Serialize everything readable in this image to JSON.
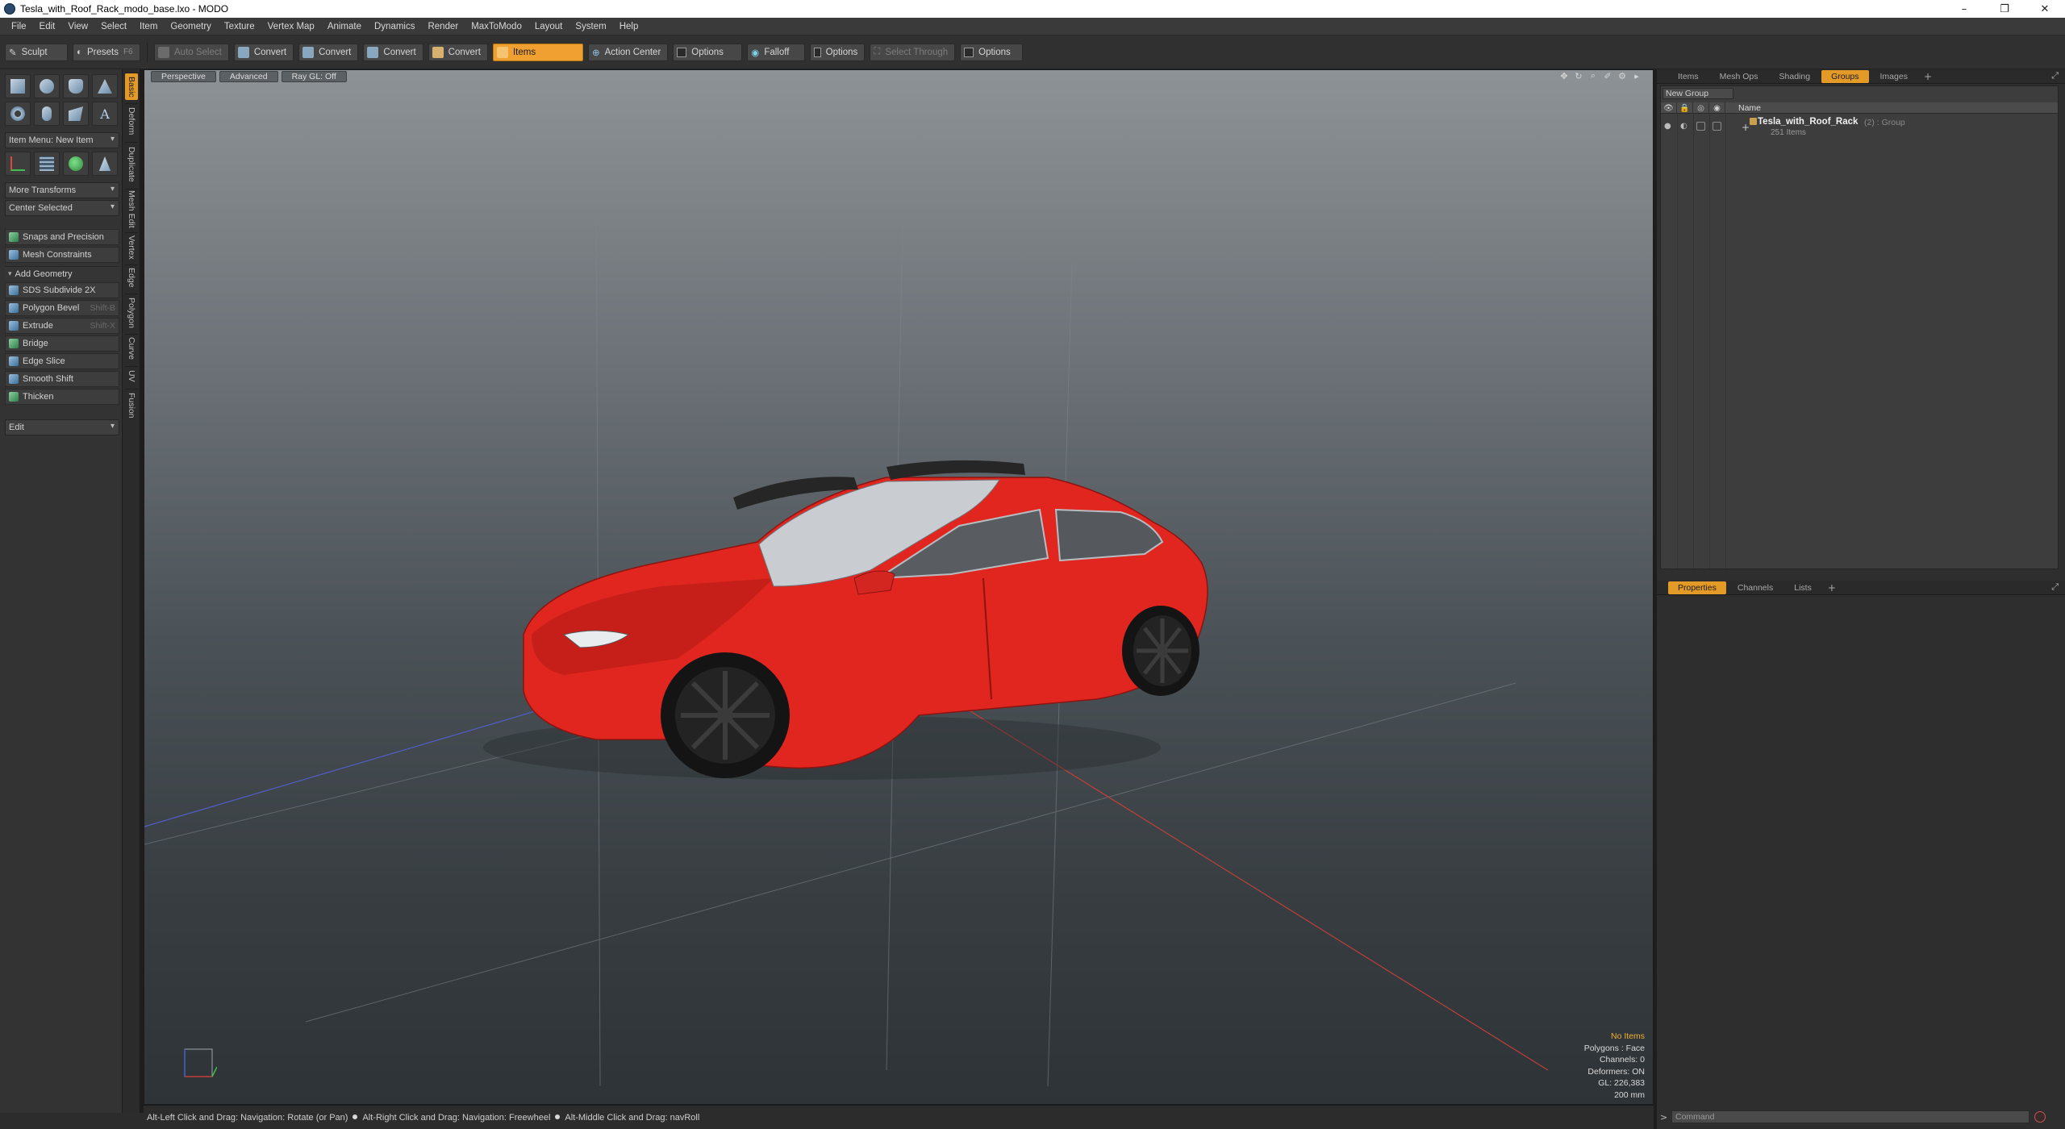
{
  "window": {
    "title": "Tesla_with_Roof_Rack_modo_base.lxo - MODO",
    "controls": [
      "–",
      "❐",
      "✕"
    ]
  },
  "menu": [
    "File",
    "Edit",
    "View",
    "Select",
    "Item",
    "Geometry",
    "Texture",
    "Vertex Map",
    "Animate",
    "Dynamics",
    "Render",
    "MaxToModo",
    "Layout",
    "System",
    "Help"
  ],
  "toolbar": {
    "sculpt": "Sculpt",
    "presets": "Presets",
    "presets_key": "F6",
    "auto_select": "Auto Select",
    "convert1": "Convert",
    "convert2": "Convert",
    "convert3": "Convert",
    "convert4": "Convert",
    "items": "Items",
    "action_center": "Action Center",
    "options1": "Options",
    "falloff": "Falloff",
    "options2": "Options",
    "select_through": "Select Through",
    "options3": "Options"
  },
  "left_panel": {
    "item_menu": "Item Menu: New Item",
    "more_transforms": "More Transforms",
    "center_selected": "Center Selected",
    "snaps": "Snaps and Precision",
    "mesh_constraints": "Mesh Constraints",
    "add_geometry": "Add Geometry",
    "tools": [
      {
        "label": "SDS Subdivide 2X",
        "shortcut": ""
      },
      {
        "label": "Polygon Bevel",
        "shortcut": "Shift-B"
      },
      {
        "label": "Extrude",
        "shortcut": "Shift-X"
      },
      {
        "label": "Bridge",
        "shortcut": ""
      },
      {
        "label": "Edge Slice",
        "shortcut": ""
      },
      {
        "label": "Smooth Shift",
        "shortcut": ""
      },
      {
        "label": "Thicken",
        "shortcut": ""
      }
    ],
    "edit": "Edit"
  },
  "side_tabs": [
    "Basic",
    "Deform",
    "Duplicate",
    "Mesh Edit",
    "Vertex",
    "Edge",
    "Polygon",
    "Curve",
    "UV",
    "Fusion"
  ],
  "viewport": {
    "tabs": [
      "Perspective",
      "Advanced",
      "Ray GL: Off"
    ],
    "stats": {
      "no_items": "No Items",
      "polygons": "Polygons : Face",
      "channels": "Channels: 0",
      "deformers": "Deformers: ON",
      "gl": "GL: 226,383",
      "unit": "200 mm"
    },
    "colors": {
      "car_body": "#e0261f",
      "selection": "#f0a030"
    }
  },
  "status_bar": {
    "hint1": "Alt-Left Click and Drag: Navigation: Rotate (or Pan)",
    "hint2": "Alt-Right Click and Drag: Navigation: Freewheel",
    "hint3": "Alt-Middle Click and Drag: navRoll"
  },
  "right_panel": {
    "tabs_top": [
      "Items",
      "Mesh Ops",
      "Shading",
      "Groups",
      "Images"
    ],
    "active_tab_top": "Groups",
    "new_group": "New Group",
    "name_header": "Name",
    "group": {
      "name": "Tesla_with_Roof_Rack",
      "meta": "(2) : Group",
      "count": "251 Items"
    },
    "tabs_bottom": [
      "Properties",
      "Channels",
      "Lists"
    ],
    "active_tab_bottom": "Properties",
    "command_placeholder": "Command"
  }
}
